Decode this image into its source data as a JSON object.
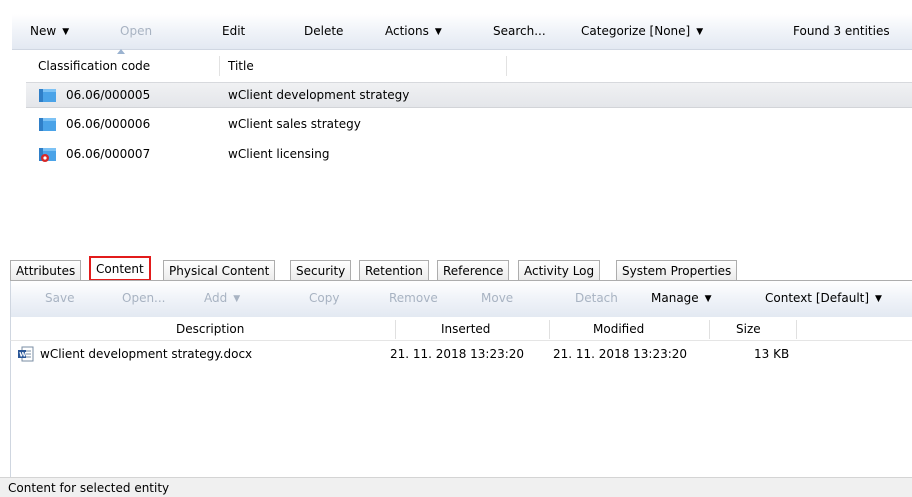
{
  "toolbar": {
    "new": "New",
    "open": "Open",
    "edit": "Edit",
    "delete": "Delete",
    "actions": "Actions",
    "search": "Search...",
    "categorize": "Categorize [None]",
    "found": "Found 3 entities"
  },
  "list": {
    "columns": [
      "Classification code",
      "Title"
    ],
    "rows": [
      {
        "code": "06.06/000005",
        "title": "wClient development strategy",
        "icon": "book-icon"
      },
      {
        "code": "06.06/000006",
        "title": "wClient sales strategy",
        "icon": "book-icon"
      },
      {
        "code": "06.06/000007",
        "title": "wClient licensing",
        "icon": "book-closed-icon"
      }
    ]
  },
  "tabs": [
    "Attributes",
    "Content",
    "Physical Content",
    "Security",
    "Retention",
    "Reference",
    "Activity Log",
    "System Properties"
  ],
  "content_toolbar": {
    "save": "Save",
    "open": "Open...",
    "add": "Add",
    "copy": "Copy",
    "remove": "Remove",
    "move": "Move",
    "detach": "Detach",
    "manage": "Manage",
    "context": "Context [Default]"
  },
  "grid": {
    "columns": [
      "Description",
      "Inserted",
      "Modified",
      "Size"
    ],
    "rows": [
      {
        "description": "wClient development strategy.docx",
        "inserted": "21. 11. 2018 13:23:20",
        "modified": "21. 11. 2018 13:23:20",
        "size": "13 KB"
      }
    ]
  },
  "status": "Content for selected entity",
  "colors": {
    "selected_tab_outline": "#e21b1b",
    "toolbar_top": "#ffffff",
    "toolbar_bottom": "#e3e9f2"
  }
}
